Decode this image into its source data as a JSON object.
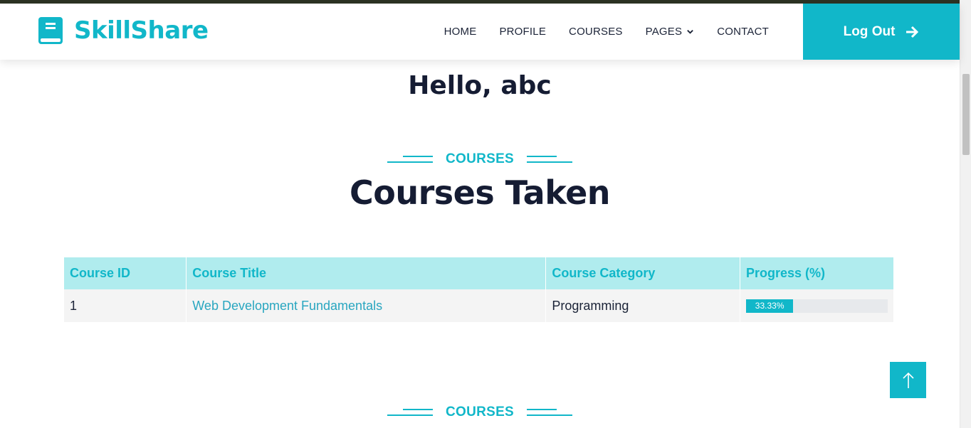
{
  "brand": {
    "name": "SkillShare",
    "icon": "book-icon"
  },
  "nav": {
    "items": [
      "HOME",
      "PROFILE",
      "COURSES",
      "PAGES",
      "CONTACT"
    ],
    "logout_label": "Log Out"
  },
  "greeting": "Hello, abc",
  "section": {
    "label": "COURSES",
    "title": "Courses Taken",
    "next_label": "COURSES"
  },
  "table": {
    "headers": [
      "Course ID",
      "Course Title",
      "Course Category",
      "Progress (%)"
    ],
    "rows": [
      {
        "id": "1",
        "title": "Web Development Fundamentals",
        "category": "Programming",
        "progress_label": "33.33%",
        "progress": 33.33
      }
    ]
  },
  "colors": {
    "accent": "#11b7c9",
    "heading": "#151c33",
    "header_bg": "#b0ecee",
    "row_bg": "#f4f4f4"
  }
}
